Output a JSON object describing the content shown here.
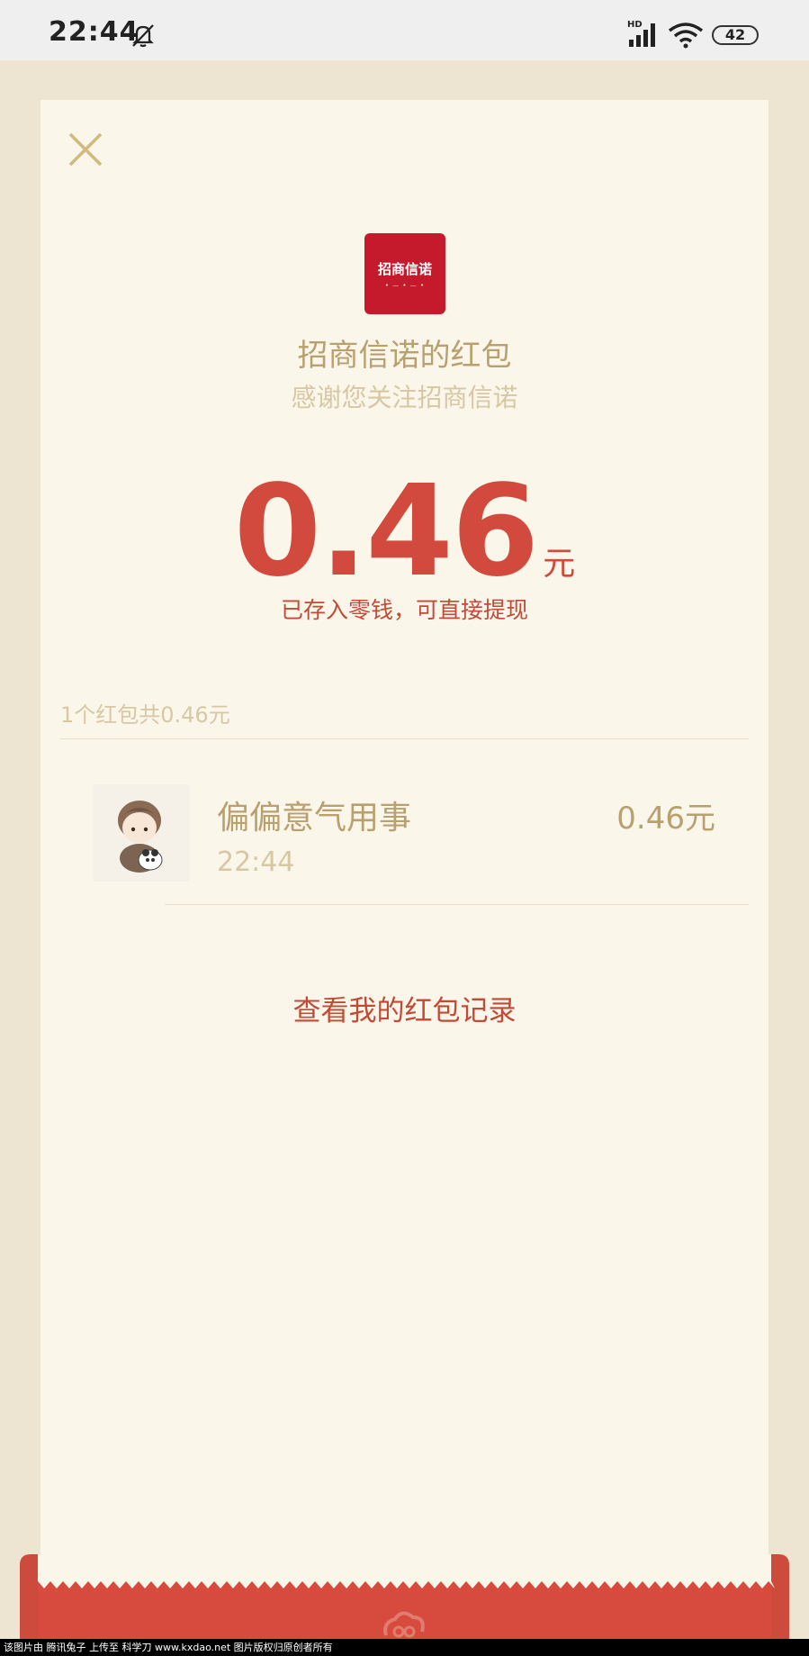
{
  "status_bar": {
    "time": "22:44",
    "bell_icon": "bell-muted-icon",
    "network": "HD",
    "battery": "42"
  },
  "packet": {
    "sender_logo_text": "招商信诺",
    "title": "招商信诺的红包",
    "subtitle": "感谢您关注招商信诺",
    "amount": "0.46",
    "unit": "元",
    "note": "已存入零钱，可直接提现",
    "summary": "1个红包共0.46元"
  },
  "receivers": [
    {
      "name": "偏偏意气用事",
      "time": "22:44",
      "amount": "0.46元"
    }
  ],
  "history_link": "查看我的红包记录",
  "watermark": "该图片由 腾讯兔子 上传至 科学刀 www.kxdao.net 图片版权归原创者所有",
  "colors": {
    "accent_red": "#d2493d",
    "gold_text": "#b9a06f",
    "card_bg": "#fbf6ea",
    "page_bg": "#ede4d1"
  }
}
